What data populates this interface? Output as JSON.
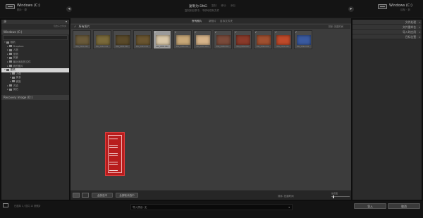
{
  "top": {
    "left_title": "Windows (C:)",
    "left_subtitle": "图片 · 源",
    "center_title": "复制为 DNG",
    "center_subtitle": "复制到目录中，不移动现有文件",
    "mode_tabs": [
      "复制为 DNG",
      "复制",
      "移动",
      "添加"
    ],
    "right_title": "Windows (C:)",
    "right_subtitle": "目标 · 到"
  },
  "left_panel": {
    "source_label": "源",
    "include_subfolders": "包含子文件夹",
    "drive_label": "Windows (C:)",
    "tree": [
      {
        "label": "相机",
        "level": 0,
        "open": true
      },
      {
        "label": "Dropbox",
        "level": 1
      },
      {
        "label": "人物",
        "level": 1
      },
      {
        "label": "宠物",
        "level": 1
      },
      {
        "label": "风景",
        "level": 1
      },
      {
        "label": "最近添加的文件",
        "level": 1
      },
      {
        "label": "我的图片",
        "level": 1
      },
      {
        "label": "建筑",
        "level": 0,
        "selected": true
      },
      {
        "label": "人像",
        "level": 2
      },
      {
        "label": "美食",
        "level": 2
      },
      {
        "label": "微距",
        "level": 2
      },
      {
        "label": "古镇",
        "level": 1
      },
      {
        "label": "街拍",
        "level": 1
      }
    ],
    "other_drive": "Recovery Image (D:)"
  },
  "center": {
    "filter_tabs": [
      "所有照片",
      "新照片",
      "目标文件夹"
    ],
    "section_title": "所有照片",
    "sort_label": "排序: 拍摄时间",
    "thumbnails": [
      {
        "caption": "IMG_2081.CR2",
        "checked": false,
        "selected": false,
        "color": "#6a5a3a"
      },
      {
        "caption": "IMG_2082.CR2",
        "checked": false,
        "selected": false,
        "color": "#7a6a3a"
      },
      {
        "caption": "IMG_2083.CR2",
        "checked": false,
        "selected": false,
        "color": "#5a4a2a"
      },
      {
        "caption": "IMG_2084.CR2",
        "checked": false,
        "selected": false,
        "color": "#6a5530"
      },
      {
        "caption": "IMG_2085.CR2",
        "checked": true,
        "selected": true,
        "color": "#d9c7a8"
      },
      {
        "caption": "IMG_2086.CR2",
        "checked": true,
        "selected": false,
        "color": "#c8a878"
      },
      {
        "caption": "IMG_2087.CR2",
        "checked": true,
        "selected": false,
        "color": "#d7b48a"
      },
      {
        "caption": "IMG_2088.CR2",
        "checked": true,
        "selected": false,
        "color": "#7a4a3a"
      },
      {
        "caption": "IMG_2089.CR2",
        "checked": true,
        "selected": false,
        "color": "#8a3a2a"
      },
      {
        "caption": "IMG_2090.CR2",
        "checked": true,
        "selected": false,
        "color": "#a05030"
      },
      {
        "caption": "IMG_2091.CR2",
        "checked": true,
        "selected": false,
        "color": "#c04a2a"
      },
      {
        "caption": "IMG_2092.CR2",
        "checked": true,
        "selected": false,
        "color": "#3a5aa0"
      }
    ],
    "check_all": "全部选中",
    "uncheck_all": "全部取消选中",
    "thumb_label": "缩览图",
    "sort_order": "排序: 拍摄时间"
  },
  "right_panel": {
    "sections": [
      "文件处理",
      "文件重命名",
      "导入时应用",
      "目标位置"
    ]
  },
  "bottom": {
    "status": "已选择 1 / 总共 12 张照片",
    "path": "导入预设: 无",
    "import_button": "导入",
    "cancel_button": "取消"
  }
}
